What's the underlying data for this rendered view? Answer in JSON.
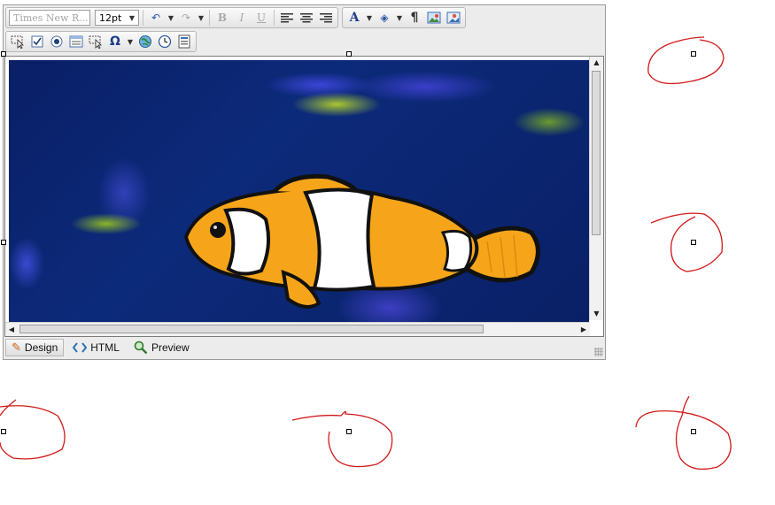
{
  "toolbar": {
    "font_family": "Times New R...",
    "font_size": "12pt",
    "buttons_row1": [
      {
        "name": "undo-icon",
        "glyph": "↶"
      },
      {
        "name": "redo-icon",
        "glyph": "↷"
      },
      {
        "name": "bold-icon",
        "glyph": "B"
      },
      {
        "name": "italic-icon",
        "glyph": "I"
      },
      {
        "name": "underline-icon",
        "glyph": "U"
      },
      {
        "name": "align-left-icon",
        "glyph": "≡"
      },
      {
        "name": "align-center-icon",
        "glyph": "≡"
      },
      {
        "name": "align-right-icon",
        "glyph": "≡"
      },
      {
        "name": "font-color-icon",
        "glyph": "A"
      },
      {
        "name": "highlight-color-icon",
        "glyph": "◈"
      },
      {
        "name": "paragraph-icon",
        "glyph": "¶"
      },
      {
        "name": "insert-image-icon",
        "glyph": "▣"
      },
      {
        "name": "image-properties-icon",
        "glyph": "▣"
      }
    ],
    "buttons_row2": [
      {
        "name": "select-pointer-icon",
        "glyph": "⬚"
      },
      {
        "name": "checkbox-icon",
        "glyph": "☑"
      },
      {
        "name": "radio-button-icon",
        "glyph": "◉"
      },
      {
        "name": "form-field-icon",
        "glyph": "▤"
      },
      {
        "name": "pointer-icon",
        "glyph": "⬚"
      },
      {
        "name": "special-character-icon",
        "glyph": "Ω"
      },
      {
        "name": "insert-link-icon",
        "glyph": "⊕"
      },
      {
        "name": "insert-time-icon",
        "glyph": "◷"
      },
      {
        "name": "insert-form-icon",
        "glyph": "▦"
      }
    ]
  },
  "tabs": [
    {
      "name": "tab-design",
      "label": "Design",
      "icon": "pencil-icon",
      "glyph": "✎"
    },
    {
      "name": "tab-html",
      "label": "HTML",
      "icon": "code-icon",
      "glyph": "◇"
    },
    {
      "name": "tab-preview",
      "label": "Preview",
      "icon": "magnifier-icon",
      "glyph": "⚲"
    }
  ],
  "colors": {
    "toolbar_bg": "#ececec",
    "annotation": "#d11a1a",
    "water": "#0c2a7a",
    "fish_orange": "#f6a51a",
    "fish_white": "#ffffff",
    "fish_outline": "#111111"
  }
}
